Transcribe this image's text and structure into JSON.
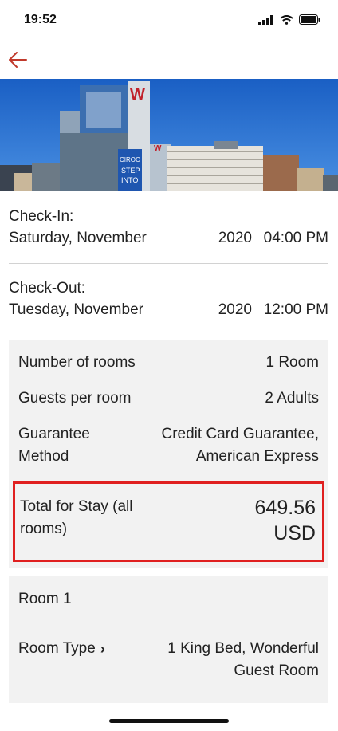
{
  "status_bar": {
    "time": "19:52"
  },
  "colors": {
    "accent": "#e02020",
    "back_arrow": "#c0392b",
    "panel_bg": "#f2f2f2"
  },
  "header": {
    "back_icon": "arrow-left-icon"
  },
  "hero_image": {
    "description_icon": "hotel-building-photo"
  },
  "check_in": {
    "label": "Check-In:",
    "day": "Saturday, November",
    "year": "2020",
    "time": "04:00 PM"
  },
  "check_out": {
    "label": "Check-Out:",
    "day": "Tuesday, November",
    "year": "2020",
    "time": "12:00 PM"
  },
  "details": {
    "rooms_label": "Number of rooms",
    "rooms_value": "1 Room",
    "guests_label": "Guests per room",
    "guests_value": "2 Adults",
    "guarantee_label_line1": "Guarantee",
    "guarantee_label_line2": "Method",
    "guarantee_value_line1": "Credit Card Guarantee,",
    "guarantee_value_line2": "American Express",
    "total_label_line1": "Total for Stay (all",
    "total_label_line2": "rooms)",
    "total_amount": "649.56",
    "total_currency": "USD"
  },
  "room": {
    "title": "Room 1",
    "type_label": "Room Type",
    "type_value_line1": "1 King Bed, Wonderful",
    "type_value_line2": "Guest Room"
  }
}
